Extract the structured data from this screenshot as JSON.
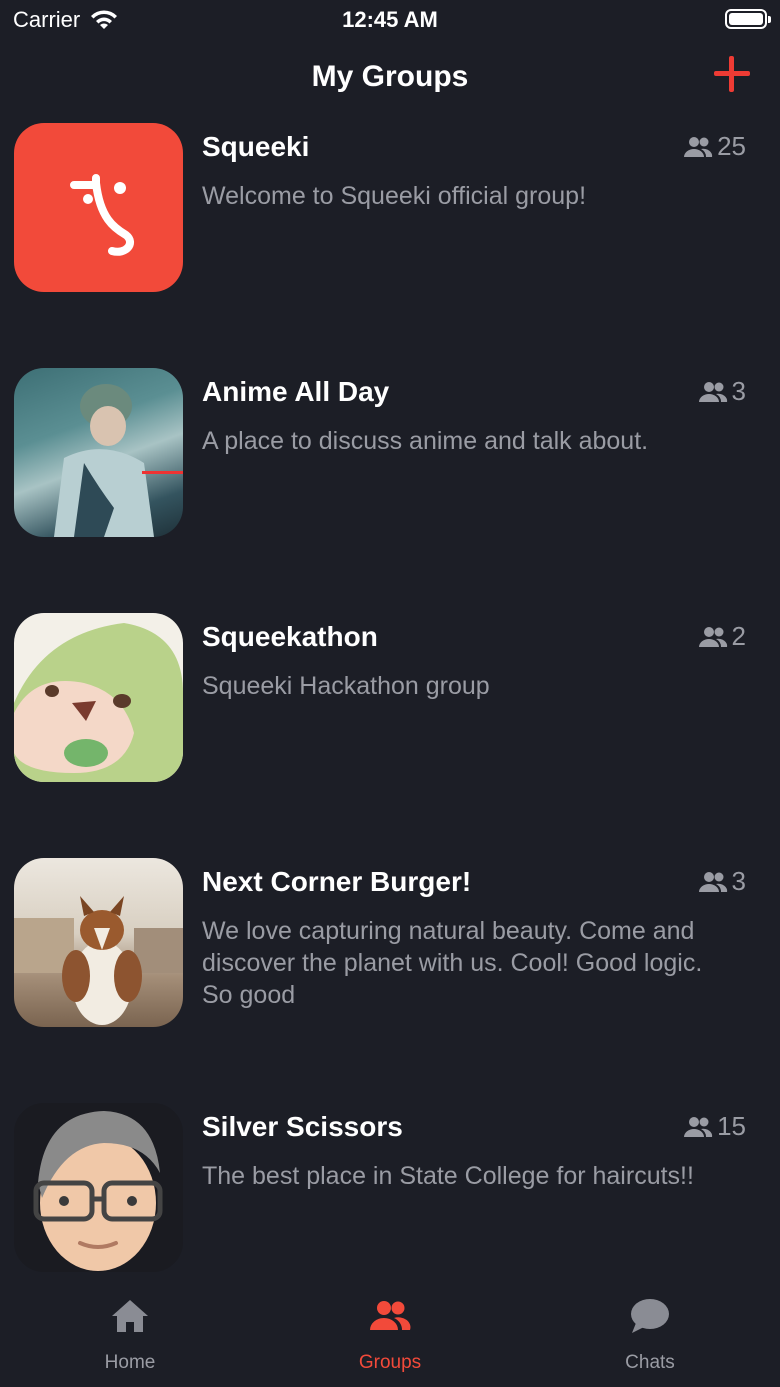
{
  "status_bar": {
    "carrier": "Carrier",
    "time": "12:45 AM",
    "wifi_icon": "wifi-icon",
    "battery_icon": "battery-icon"
  },
  "header": {
    "title": "My Groups",
    "add_icon": "plus-icon",
    "accent_color": "#ee3b34"
  },
  "groups": [
    {
      "name": "Squeeki",
      "members": "25",
      "description": "Welcome to Squeeki official group!",
      "avatar": "squeeki-logo"
    },
    {
      "name": "Anime All Day",
      "members": "3",
      "description": "A place to discuss anime and talk about.",
      "avatar": "anime-character-image"
    },
    {
      "name": "Squeekathon",
      "members": "2",
      "description": "Squeeki Hackathon group",
      "avatar": "green-creature-image"
    },
    {
      "name": "Next Corner Burger!",
      "members": "3",
      "description": "We love capturing natural beauty.  Come and discover the planet with us.  Cool! Good logic.  So good",
      "avatar": "dog-photo"
    },
    {
      "name": "Silver Scissors",
      "members": "15",
      "description": "The best place in State College for haircuts!!",
      "avatar": "memoji-avatar"
    }
  ],
  "tabs": [
    {
      "label": "Home",
      "icon": "home-icon",
      "active": false
    },
    {
      "label": "Groups",
      "icon": "groups-icon",
      "active": true
    },
    {
      "label": "Chats",
      "icon": "chat-bubble-icon",
      "active": false
    }
  ],
  "colors": {
    "background": "#1c1e26",
    "muted_text": "#9a9ca4",
    "active_tab": "#f24a3a"
  }
}
